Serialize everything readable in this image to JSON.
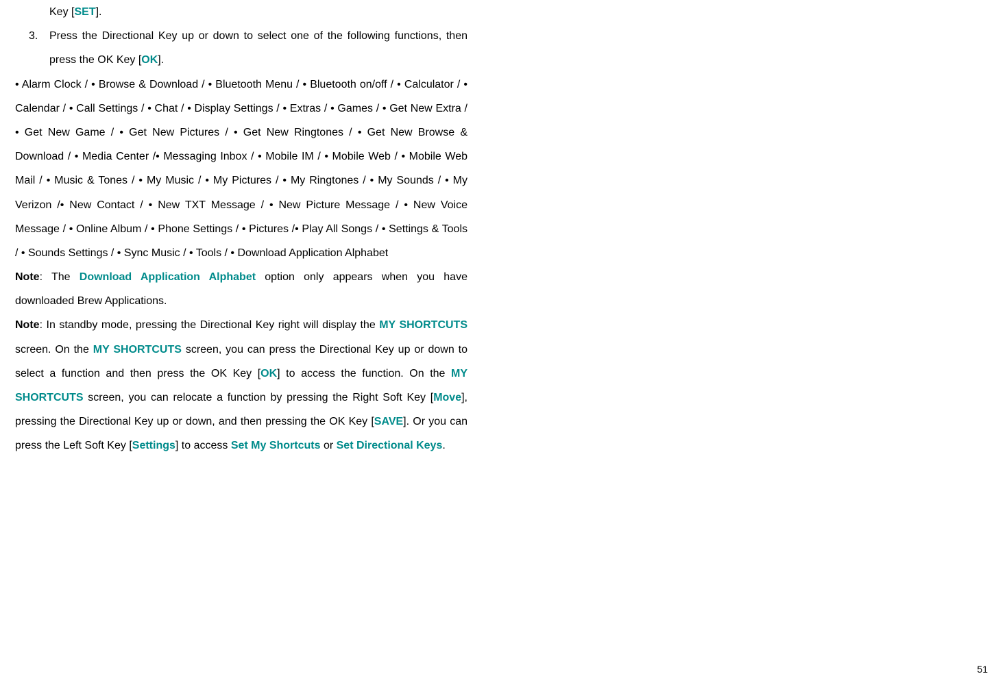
{
  "line1_prefix": "Key [",
  "line1_set": "SET",
  "line1_suffix": "].",
  "ol_num": "3.",
  "ol_text_prefix": "Press the Directional Key up or down to select one of the following functions, then press the OK Key [",
  "ol_ok": "OK",
  "ol_text_suffix": "].",
  "functions_list": "• Alarm Clock / • Browse & Download / • Bluetooth Menu / • Bluetooth on/off / •  Calculator / • Calendar / • Call Settings / • Chat / • Display Settings / • Extras / • Games / • Get New Extra / • Get New Game / • Get New Pictures / • Get New Ringtones / • Get New Browse & Download / • Media Center /• Messaging Inbox / • Mobile IM / • Mobile Web / • Mobile Web Mail / • Music & Tones / • My Music / • My Pictures / • My Ringtones / • My Sounds / • My Verizon /• New Contact / • New TXT Message / • New Picture Message / • New Voice Message / • Online Album / • Phone Settings / • Pictures /• Play All Songs / • Settings & Tools / • Sounds Settings / • Sync Music / • Tools / • Download Application Alphabet",
  "note1_label": "Note",
  "note1_prefix": ": The ",
  "note1_teal": "Download Application Alphabet",
  "note1_suffix": " option only appears when you have downloaded Brew Applications.",
  "note2_label": "Note",
  "note2_prefix": ": In standby mode, pressing the Directional Key right will display the ",
  "note2_shortcuts1": "MY SHORTCUTS",
  "note2_part2": " screen. On the ",
  "note2_shortcuts2": "MY SHORTCUTS",
  "note2_part3": " screen, you can press the Directional Key up or down to select a function and then press the OK Key [",
  "note2_ok": "OK",
  "note2_part4": "] to access the function. On the ",
  "note2_shortcuts3": "MY SHORTCUTS",
  "note2_part5": " screen, you can relocate a function by pressing the Right Soft Key [",
  "note2_move": "Move",
  "note2_part6": "], pressing the Directional Key up or down, and then pressing the OK Key [",
  "note2_save": "SAVE",
  "note2_part7": "]. Or you can press the Left Soft Key [",
  "note2_settings": "Settings",
  "note2_part8": "] to access ",
  "note2_setmy": "Set My Shortcuts",
  "note2_part9": " or ",
  "note2_setdir": "Set Directional Keys",
  "note2_part10": ".",
  "page_number": "51"
}
